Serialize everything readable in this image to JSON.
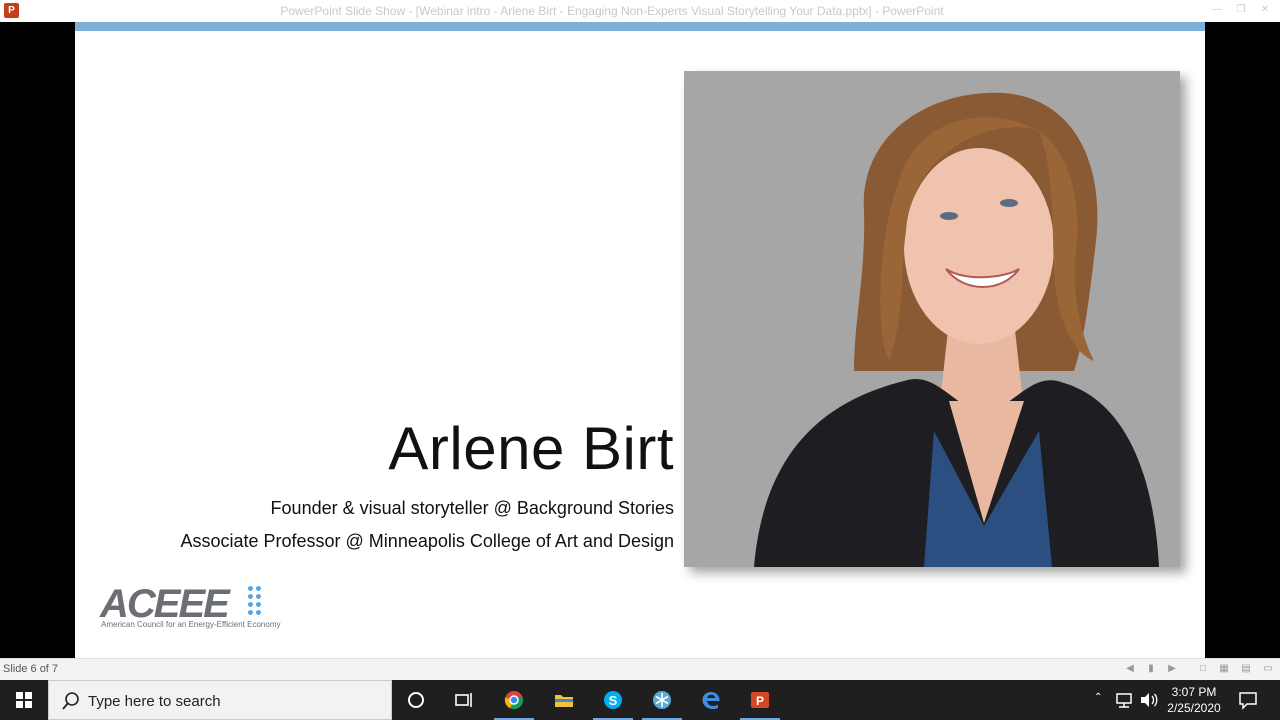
{
  "window": {
    "title": "PowerPoint Slide Show - [Webinar intro - Arlene Birt - Engaging Non-Experts Visual Storytelling Your Data.pptx] - PowerPoint",
    "app_icon": "P"
  },
  "slide": {
    "name": "Arlene Birt",
    "subtitle1": "Founder & visual storyteller @ Background Stories",
    "subtitle2": "Associate Professor @ Minneapolis College of Art and Design",
    "logo_text": "ACEEE",
    "logo_tagline": "American Council for an Energy-Efficient Economy",
    "accent_color": "#7fb0da"
  },
  "statusbar": {
    "slide_count": "Slide 6 of 7"
  },
  "taskbar": {
    "search_placeholder": "Type here to search",
    "time": "3:07 PM",
    "date": "2/25/2020",
    "pinned": [
      "cortana-icon",
      "task-view-icon",
      "chrome-icon",
      "file-explorer-icon",
      "skype-icon",
      "snowflake-app-icon",
      "edge-icon",
      "powerpoint-icon"
    ]
  }
}
